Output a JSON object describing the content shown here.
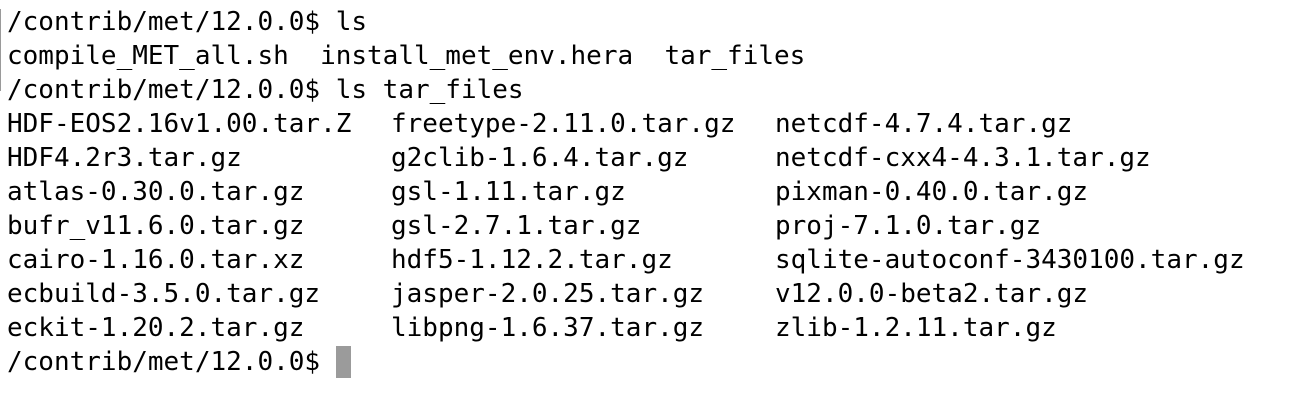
{
  "terminal": {
    "lines": [
      "/contrib/met/12.0.0$ ls",
      "compile_MET_all.sh  install_met_env.hera  tar_files",
      "/contrib/met/12.0.0$ ls tar_files"
    ],
    "files": [
      [
        "HDF-EOS2.16v1.00.tar.Z",
        "freetype-2.11.0.tar.gz",
        "netcdf-4.7.4.tar.gz"
      ],
      [
        "HDF4.2r3.tar.gz",
        "g2clib-1.6.4.tar.gz",
        "netcdf-cxx4-4.3.1.tar.gz"
      ],
      [
        "atlas-0.30.0.tar.gz",
        "gsl-1.11.tar.gz",
        "pixman-0.40.0.tar.gz"
      ],
      [
        "bufr_v11.6.0.tar.gz",
        "gsl-2.7.1.tar.gz",
        "proj-7.1.0.tar.gz"
      ],
      [
        "cairo-1.16.0.tar.xz",
        "hdf5-1.12.2.tar.gz",
        "sqlite-autoconf-3430100.tar.gz"
      ],
      [
        "ecbuild-3.5.0.tar.gz",
        "jasper-2.0.25.tar.gz",
        "v12.0.0-beta2.tar.gz"
      ],
      [
        "eckit-1.20.2.tar.gz",
        "libpng-1.6.37.tar.gz",
        "zlib-1.2.11.tar.gz"
      ]
    ],
    "prompt": "/contrib/met/12.0.0$",
    "colors": {
      "background": "#ffffff",
      "text": "#000000",
      "cursor": "#9b9b9b"
    }
  }
}
